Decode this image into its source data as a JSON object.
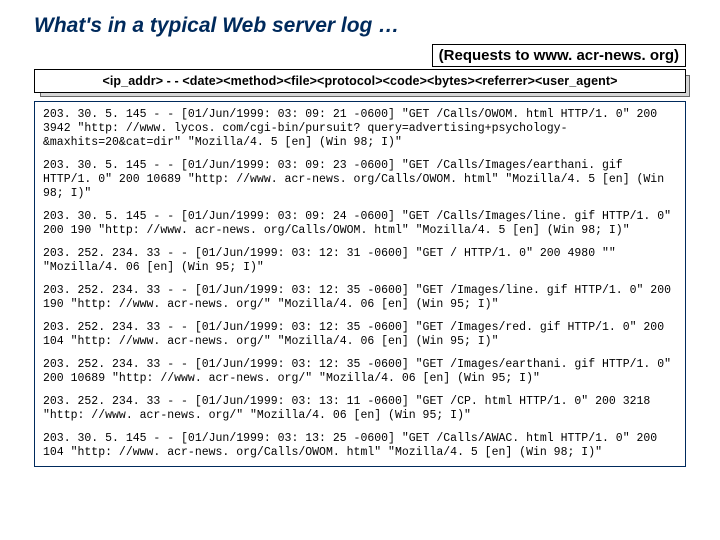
{
  "title": "What's in a typical Web server log …",
  "subtitle": "(Requests to www. acr-news. org)",
  "format_line": "<ip_addr> - - <date><method><file><protocol><code><bytes><referrer><user_agent>",
  "log_entries": [
    "203. 30. 5. 145 - - [01/Jun/1999: 03: 09: 21 -0600] \"GET /Calls/OWOM. html HTTP/1. 0\" 200 3942 \"http: //www. lycos. com/cgi-bin/pursuit? query=advertising+psychology-&maxhits=20&cat=dir\" \"Mozilla/4. 5 [en] (Win 98; I)\"",
    "203. 30. 5. 145 - - [01/Jun/1999: 03: 09: 23 -0600] \"GET /Calls/Images/earthani. gif HTTP/1. 0\" 200 10689 \"http: //www. acr-news. org/Calls/OWOM. html\" \"Mozilla/4. 5 [en] (Win 98; I)\"",
    "203. 30. 5. 145 - - [01/Jun/1999: 03: 09: 24 -0600] \"GET /Calls/Images/line. gif HTTP/1. 0\" 200 190 \"http: //www. acr-news. org/Calls/OWOM. html\" \"Mozilla/4. 5 [en] (Win 98; I)\"",
    "203. 252. 234. 33 - - [01/Jun/1999: 03: 12: 31 -0600] \"GET / HTTP/1. 0\" 200 4980 \"\" \"Mozilla/4. 06 [en] (Win 95; I)\"",
    "203. 252. 234. 33 - - [01/Jun/1999: 03: 12: 35 -0600] \"GET /Images/line. gif HTTP/1. 0\" 200 190 \"http: //www. acr-news. org/\" \"Mozilla/4. 06 [en] (Win 95; I)\"",
    "203. 252. 234. 33 - - [01/Jun/1999: 03: 12: 35 -0600] \"GET /Images/red. gif HTTP/1. 0\" 200 104 \"http: //www. acr-news. org/\" \"Mozilla/4. 06 [en] (Win 95; I)\"",
    "203. 252. 234. 33 - - [01/Jun/1999: 03: 12: 35 -0600] \"GET /Images/earthani. gif HTTP/1. 0\" 200 10689 \"http: //www. acr-news. org/\" \"Mozilla/4. 06 [en] (Win 95; I)\"",
    "203. 252. 234. 33 - - [01/Jun/1999: 03: 13: 11 -0600] \"GET /CP. html HTTP/1. 0\" 200 3218 \"http: //www. acr-news. org/\" \"Mozilla/4. 06 [en] (Win 95; I)\"",
    "203. 30. 5. 145 - - [01/Jun/1999: 03: 13: 25 -0600] \"GET /Calls/AWAC. html HTTP/1. 0\" 200 104 \"http: //www. acr-news. org/Calls/OWOM. html\" \"Mozilla/4. 5 [en] (Win 98; I)\""
  ]
}
